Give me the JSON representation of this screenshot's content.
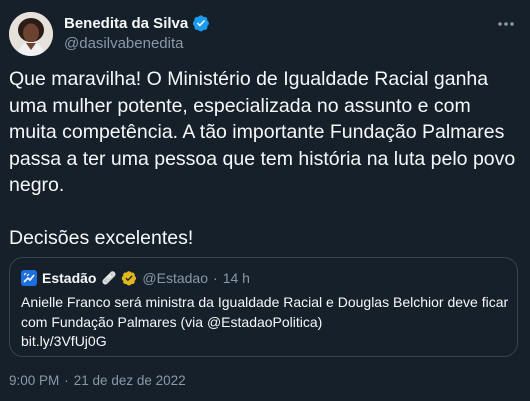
{
  "author": {
    "display_name": "Benedita da Silva",
    "handle": "@dasilvabenedita",
    "verified": true,
    "avatar_icon": "profile-photo"
  },
  "tweet": {
    "text": "Que maravilha! O Ministério de Igualdade Racial ganha uma mulher potente, especializada no assunto e com muita competência. A tão importante Fundação Palmares passa a ter uma pessoa que tem história na luta pelo povo negro.\n\nDecisões excelentes!",
    "time": "9:00 PM",
    "separator": "·",
    "date": "21 de dez de 2022"
  },
  "quoted_tweet": {
    "display_name": "Estadão",
    "name_emoji": "🩹",
    "handle": "@Estadao",
    "separator": "·",
    "time": "14 h",
    "text": "Anielle Franco será ministra da Igualdade Racial e Douglas Belchior deve ficar com Fundação Palmares (via @EstadaoPolitica)",
    "link": "bit.ly/3VfUj0G",
    "badge": "gold-verified-icon"
  },
  "colors": {
    "background": "#15202b",
    "text": "#f7f9f9",
    "secondary_text": "#8b98a5",
    "border": "#38444d",
    "verified_blue": "#1d9bf0",
    "gold_badge": "#e2b719"
  },
  "icons": {
    "more": "more-horizontal-icon",
    "verified": "verified-badge-icon",
    "logo": "estadao-logo-icon"
  }
}
